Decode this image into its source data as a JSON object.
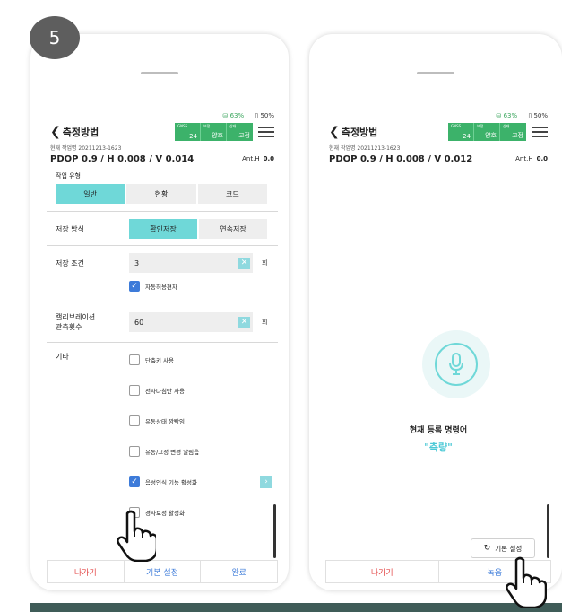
{
  "step_number": "5",
  "left": {
    "status": {
      "gnss": "63%",
      "battery": "50%"
    },
    "title": "측정방법",
    "gnss_panel": {
      "labels": [
        "GNSS",
        "보정",
        "상태"
      ],
      "values": [
        "24",
        "양호",
        "고정"
      ]
    },
    "job": "현재 작업명 20211213-1623",
    "pdop": "PDOP 0.9 / H 0.008 / V 0.014",
    "ant_label": "Ant.H",
    "ant_value": "0.0",
    "work_type_label": "작업 유형",
    "work_types": [
      "일반",
      "현황",
      "코드"
    ],
    "save_method_label": "저장 방식",
    "save_methods": [
      "확인저장",
      "연속저장"
    ],
    "save_condition_label": "저장 조건",
    "save_condition_value": "3",
    "save_condition_unit": "회",
    "auto_tolerance_label": "자동허용편차",
    "calibration_label_1": "캘리브레이션",
    "calibration_label_2": "관측횟수",
    "calibration_value": "60",
    "calibration_unit": "회",
    "other_label": "기타",
    "options": [
      "단축키 사용",
      "전자나침반 사용",
      "유동상태 깜빡임",
      "유동/고정 변경 알림음",
      "음성인식 기능 활성화",
      "경사보정 활성화"
    ],
    "options_checked": [
      false,
      false,
      false,
      false,
      true,
      false
    ],
    "bottom": {
      "exit": "나가기",
      "default": "기본 설정",
      "done": "완료"
    }
  },
  "right": {
    "status": {
      "gnss": "63%",
      "battery": "50%"
    },
    "title": "측정방법",
    "gnss_panel": {
      "labels": [
        "GNSS",
        "보정",
        "상태"
      ],
      "values": [
        "24",
        "양호",
        "고정"
      ]
    },
    "job": "현재 작업명 20211213-1623",
    "pdop": "PDOP 0.9 / H 0.008 / V 0.012",
    "ant_label": "Ant.H",
    "ant_value": "0.0",
    "cmd_label": "현재 등록 명령어",
    "cmd_value": "\"측량\"",
    "reset": "기본 설정",
    "bottom": {
      "exit": "나가기",
      "record": "녹음"
    }
  },
  "colors": {
    "accent": "#6fd8d8",
    "gnss_green": "#3cb26a",
    "exit_red": "#e34a4a",
    "blue": "#3d7bd9"
  }
}
